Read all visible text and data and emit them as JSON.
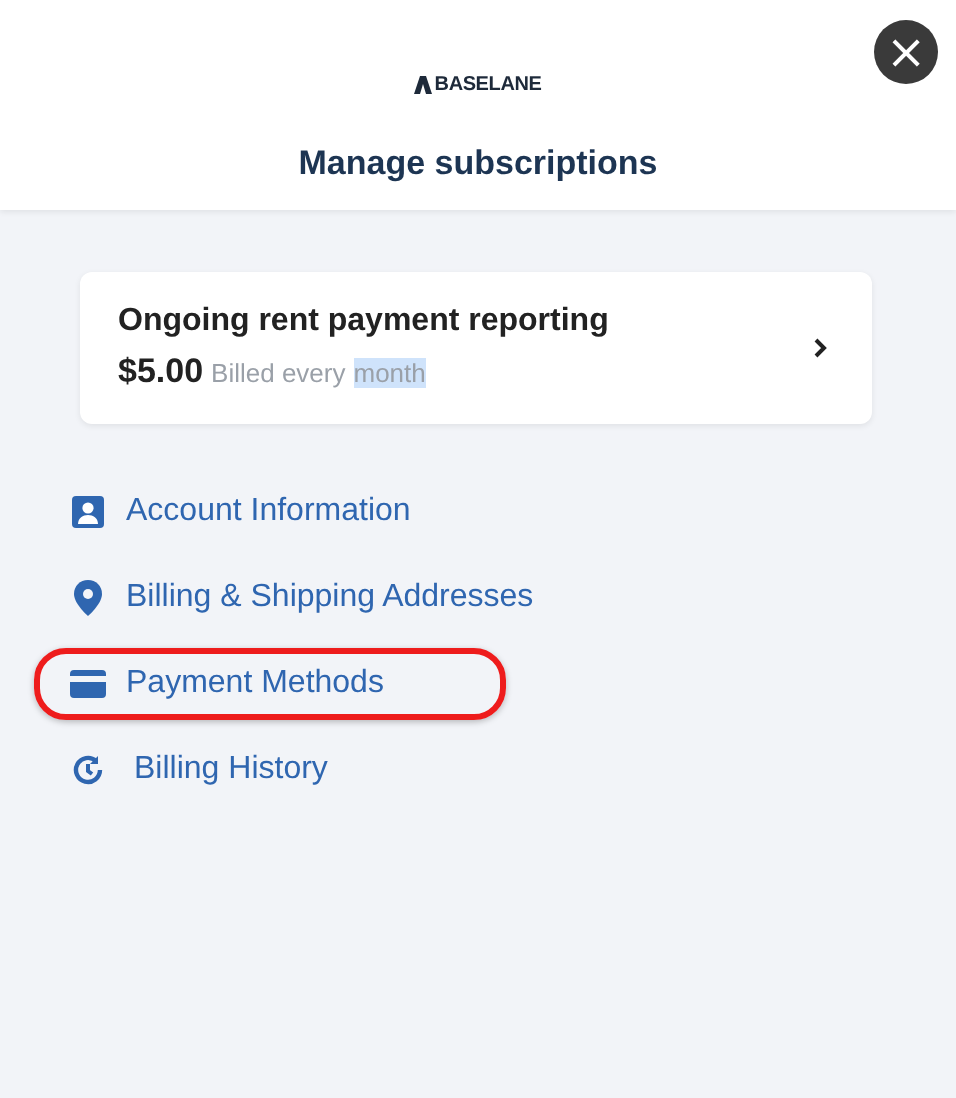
{
  "header": {
    "logo": "BASELANE",
    "title": "Manage subscriptions",
    "close_label": "×"
  },
  "subscription": {
    "name": "Ongoing rent payment reporting",
    "price": "$5.00",
    "note_parts": [
      {
        "text": "Billed every",
        "selected": false
      },
      {
        "text": "month",
        "selected": true
      }
    ]
  },
  "links": [
    {
      "kind": "account",
      "label": "Account Information",
      "highlighted": false
    },
    {
      "kind": "address",
      "label": "Billing & Shipping Addresses",
      "highlighted": false
    },
    {
      "kind": "payment",
      "label": "Payment Methods",
      "highlighted": true
    },
    {
      "kind": "history",
      "label": "Billing History",
      "highlighted": false
    }
  ]
}
